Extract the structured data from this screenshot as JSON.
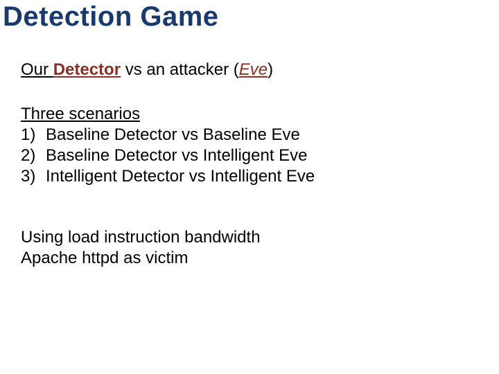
{
  "title": "Detection Game",
  "intro": {
    "prefix": "Our ",
    "detector": "Detector",
    "middle": " vs an attacker (",
    "eve": "Eve",
    "suffix": ")"
  },
  "scenarios": {
    "heading": "Three scenarios",
    "items": [
      {
        "num": "1)",
        "text": "Baseline Detector vs Baseline Eve"
      },
      {
        "num": "2)",
        "text": "Baseline Detector vs Intelligent Eve"
      },
      {
        "num": "3)",
        "text": "Intelligent Detector vs Intelligent Eve"
      }
    ]
  },
  "closing": {
    "line1": "Using load instruction bandwidth",
    "line2": "Apache httpd as victim"
  }
}
